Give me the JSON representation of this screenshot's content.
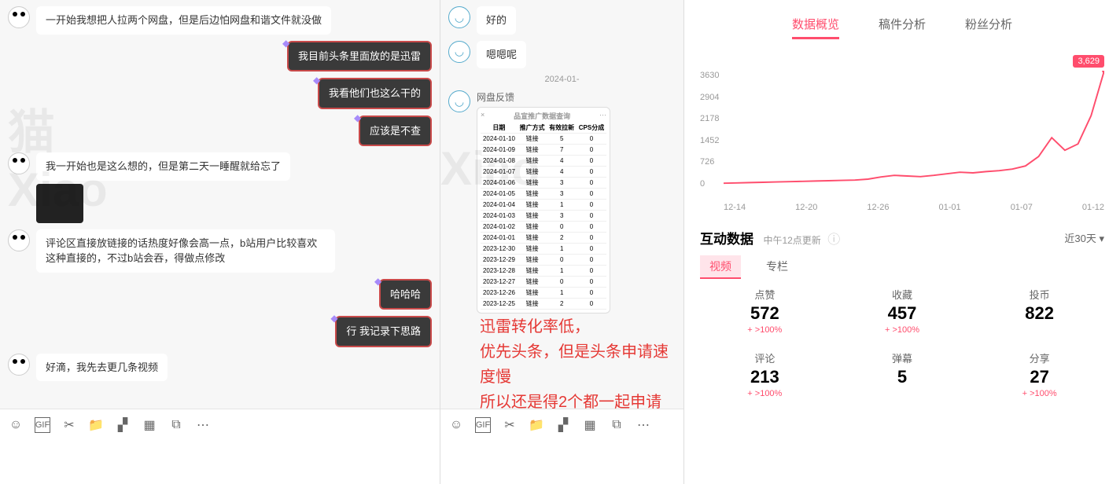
{
  "chat1": {
    "msgs": [
      {
        "side": "left",
        "text": "一开始我想把人拉两个网盘，但是后边怕网盘和谐文件就没做"
      },
      {
        "side": "right",
        "text": "我目前头条里面放的是迅雷"
      },
      {
        "side": "right",
        "text": "我看他们也这么干的"
      },
      {
        "side": "right",
        "text": "应该是不查"
      },
      {
        "side": "left",
        "text": "我一开始也是这么想的，但是第二天一睡醒就给忘了",
        "img": true
      },
      {
        "side": "left",
        "text": "评论区直接放链接的话热度好像会高一点，b站用户比较喜欢这种直接的，不过b站会吞，得做点修改"
      },
      {
        "side": "right",
        "text": "哈哈哈"
      },
      {
        "side": "right",
        "text": "行  我记录下思路"
      },
      {
        "side": "left",
        "text": "好滴，我先去更几条视频"
      }
    ]
  },
  "chat2": {
    "msgs": [
      {
        "side": "left",
        "text": "好的"
      },
      {
        "side": "left",
        "text": "嗯嗯呢"
      }
    ],
    "date": "2024-01-",
    "feedback_label": "网盘反馈",
    "table": {
      "title": "品宣推广数据查询",
      "close": "×",
      "more": "···",
      "headers": [
        "日期",
        "推广方式",
        "有效拉新",
        "CPS分成"
      ],
      "rows": [
        [
          "2024-01-10",
          "链接",
          "5",
          "0"
        ],
        [
          "2024-01-09",
          "链接",
          "7",
          "0"
        ],
        [
          "2024-01-08",
          "链接",
          "4",
          "0"
        ],
        [
          "2024-01-07",
          "链接",
          "4",
          "0"
        ],
        [
          "2024-01-06",
          "链接",
          "3",
          "0"
        ],
        [
          "2024-01-05",
          "链接",
          "3",
          "0"
        ],
        [
          "2024-01-04",
          "链接",
          "1",
          "0"
        ],
        [
          "2024-01-03",
          "链接",
          "3",
          "0"
        ],
        [
          "2024-01-02",
          "链接",
          "0",
          "0"
        ],
        [
          "2024-01-01",
          "链接",
          "2",
          "0"
        ],
        [
          "2023-12-30",
          "链接",
          "1",
          "0"
        ],
        [
          "2023-12-29",
          "链接",
          "0",
          "0"
        ],
        [
          "2023-12-28",
          "链接",
          "1",
          "0"
        ],
        [
          "2023-12-27",
          "链接",
          "0",
          "0"
        ],
        [
          "2023-12-26",
          "链接",
          "1",
          "0"
        ],
        [
          "2023-12-25",
          "链接",
          "2",
          "0"
        ]
      ]
    }
  },
  "annotation": {
    "line1": "迅雷转化率低，",
    "line2": "优先头条，但是头条申请速度慢",
    "line3": "所以还是得2个都一起申请"
  },
  "toolbar": {
    "icons": [
      "emoji",
      "gif",
      "scissors",
      "folder",
      "sticker",
      "image",
      "screenshot",
      "more"
    ]
  },
  "analytics": {
    "tabs": [
      "数据概览",
      "稿件分析",
      "粉丝分析"
    ],
    "active_tab": 0,
    "chart_peak": "3,629",
    "section_title": "互动数据",
    "section_sub": "中午12点更新",
    "period": "近30天",
    "subtabs": [
      "视频",
      "专栏"
    ],
    "active_subtab": 0,
    "stats": [
      {
        "label": "点赞",
        "value": "572",
        "delta": "+ >100%"
      },
      {
        "label": "收藏",
        "value": "457",
        "delta": "+ >100%"
      },
      {
        "label": "投币",
        "value": "822",
        "delta": ""
      },
      {
        "label": "评论",
        "value": "213",
        "delta": "+ >100%"
      },
      {
        "label": "弹幕",
        "value": "5",
        "delta": ""
      },
      {
        "label": "分享",
        "value": "27",
        "delta": "+ >100%"
      }
    ]
  },
  "chart_data": {
    "type": "line",
    "title": "",
    "xlabel": "",
    "ylabel": "",
    "ylim": [
      0,
      3630
    ],
    "y_ticks": [
      0,
      726,
      1452,
      2178,
      2904,
      3630
    ],
    "categories": [
      "12-14",
      "12-20",
      "12-26",
      "01-01",
      "01-07",
      "01-12"
    ],
    "x": [
      "12-14",
      "12-15",
      "12-16",
      "12-17",
      "12-18",
      "12-19",
      "12-20",
      "12-21",
      "12-22",
      "12-23",
      "12-24",
      "12-25",
      "12-26",
      "12-27",
      "12-28",
      "12-29",
      "12-30",
      "12-31",
      "01-01",
      "01-02",
      "01-03",
      "01-04",
      "01-05",
      "01-06",
      "01-07",
      "01-08",
      "01-09",
      "01-10",
      "01-11",
      "01-12"
    ],
    "values": [
      50,
      60,
      70,
      80,
      90,
      100,
      110,
      120,
      130,
      140,
      150,
      180,
      250,
      300,
      280,
      260,
      300,
      350,
      400,
      380,
      420,
      450,
      500,
      600,
      900,
      1500,
      1100,
      1300,
      2200,
      3629
    ],
    "peak_label": "3,629"
  }
}
